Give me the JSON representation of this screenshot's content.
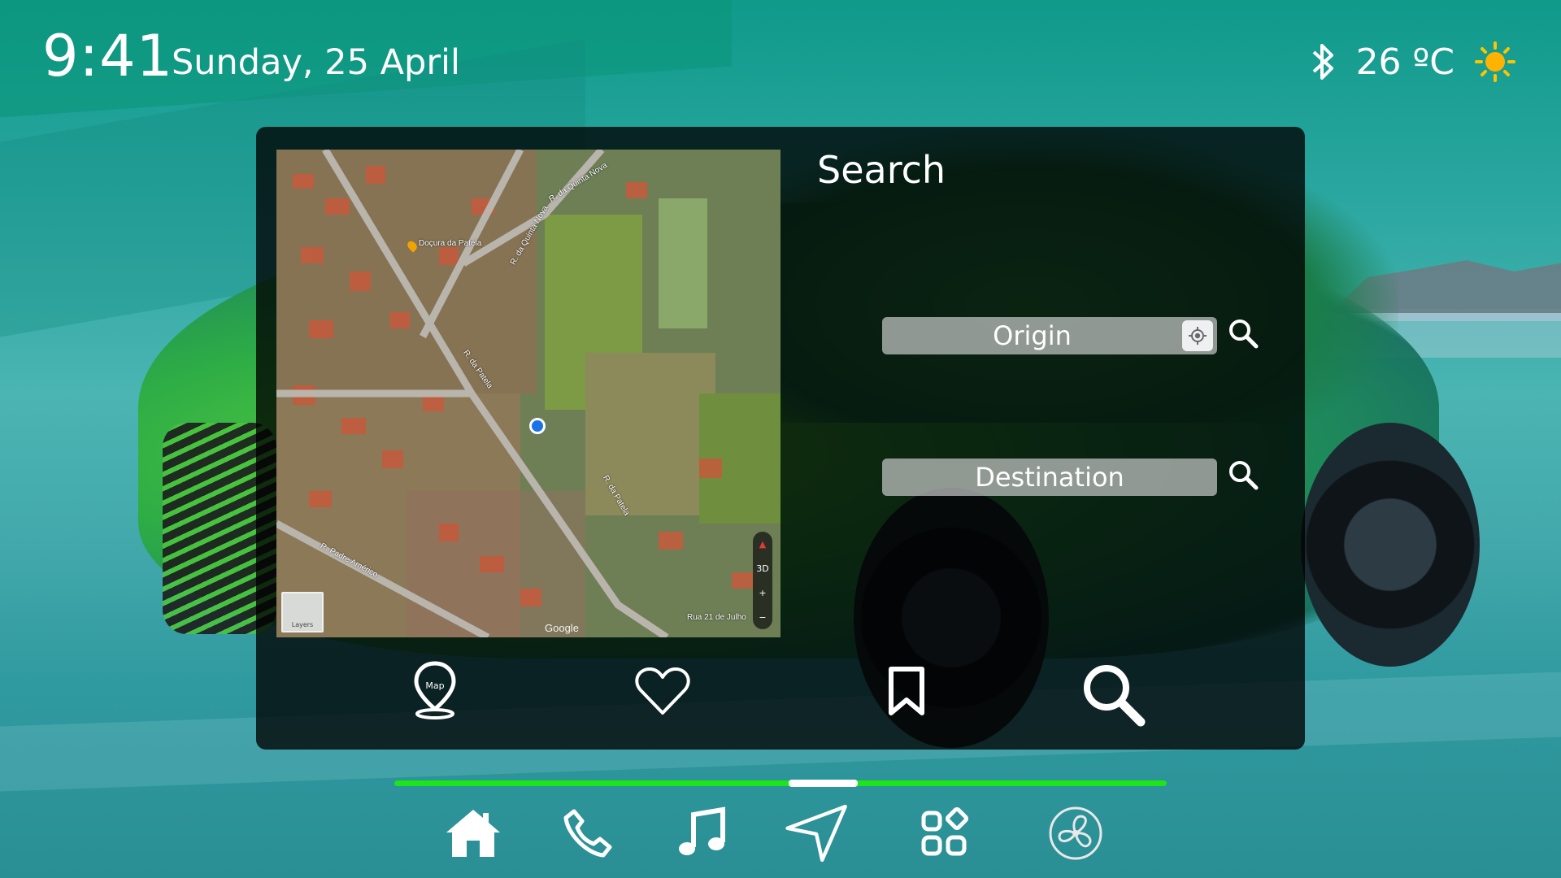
{
  "status": {
    "time": "9:41",
    "date": "Sunday, 25 April",
    "temperature": "26 ºC",
    "icons": [
      "bluetooth-icon",
      "sun-icon"
    ]
  },
  "map": {
    "attribution": "Google",
    "layers_label": "Layers",
    "controls": [
      "3D",
      "+",
      "−"
    ],
    "poi_label": "Doçura da Patela",
    "streets": [
      "R. da Quinta Nova",
      "R. da Patela",
      "R. Padre Américo",
      "R. da Patela",
      "Rua 21 de Julho",
      "R. da Quinta Nova"
    ]
  },
  "search": {
    "title": "Search",
    "origin_label": "Origin",
    "destination_label": "Destination"
  },
  "panel_tabs": [
    {
      "name": "map",
      "icon": "map-pin-icon",
      "label": "Map"
    },
    {
      "name": "favorites",
      "icon": "heart-icon"
    },
    {
      "name": "saved",
      "icon": "bookmark-icon"
    },
    {
      "name": "search",
      "icon": "search-icon"
    }
  ],
  "dock": [
    {
      "name": "home",
      "icon": "home-icon"
    },
    {
      "name": "phone",
      "icon": "phone-icon"
    },
    {
      "name": "music",
      "icon": "music-icon"
    },
    {
      "name": "navigation",
      "icon": "navigation-arrow-icon"
    },
    {
      "name": "apps",
      "icon": "apps-icon"
    },
    {
      "name": "climate",
      "icon": "fan-icon"
    }
  ],
  "colors": {
    "accent_green": "#1ee41a",
    "panel_bg": "rgba(0,0,0,0.78)",
    "field_bg": "rgba(210,210,210,0.68)"
  },
  "page_indicator": {
    "active_fraction_start": 0.51,
    "active_fraction_end": 0.6
  }
}
